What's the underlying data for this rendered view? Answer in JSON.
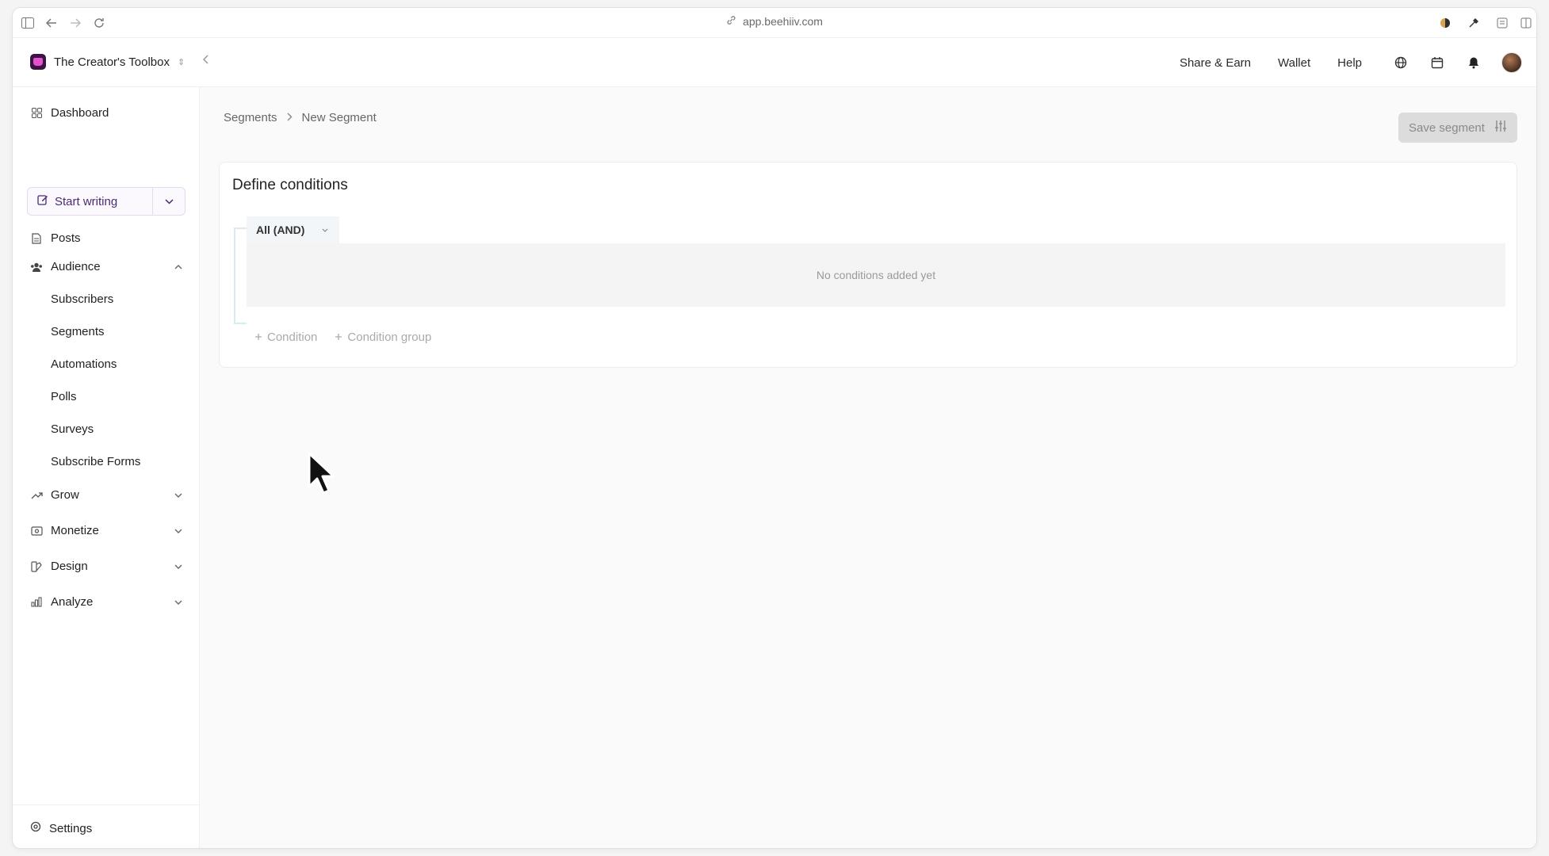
{
  "browser": {
    "url": "app.beehiiv.com"
  },
  "header": {
    "publication_name": "The Creator's Toolbox",
    "links": [
      "Share & Earn",
      "Wallet",
      "Help"
    ]
  },
  "sidebar": {
    "dashboard": "Dashboard",
    "start_writing": "Start writing",
    "posts": "Posts",
    "audience": "Audience",
    "audience_items": [
      "Subscribers",
      "Segments",
      "Automations",
      "Polls",
      "Surveys",
      "Subscribe Forms"
    ],
    "grow": "Grow",
    "monetize": "Monetize",
    "design": "Design",
    "analyze": "Analyze",
    "settings": "Settings"
  },
  "main": {
    "breadcrumb": [
      "Segments",
      "New Segment"
    ],
    "save_button": "Save segment",
    "card_title": "Define conditions",
    "group_operator": "All (AND)",
    "empty_message": "No conditions added yet",
    "add_condition": "Condition",
    "add_condition_group": "Condition group"
  },
  "colors": {
    "accent_purple": "#4b2a73",
    "brand_logo": "#e84fcf",
    "save_disabled_bg": "#dcdcdc",
    "group_rail": "#d8ecf6"
  }
}
